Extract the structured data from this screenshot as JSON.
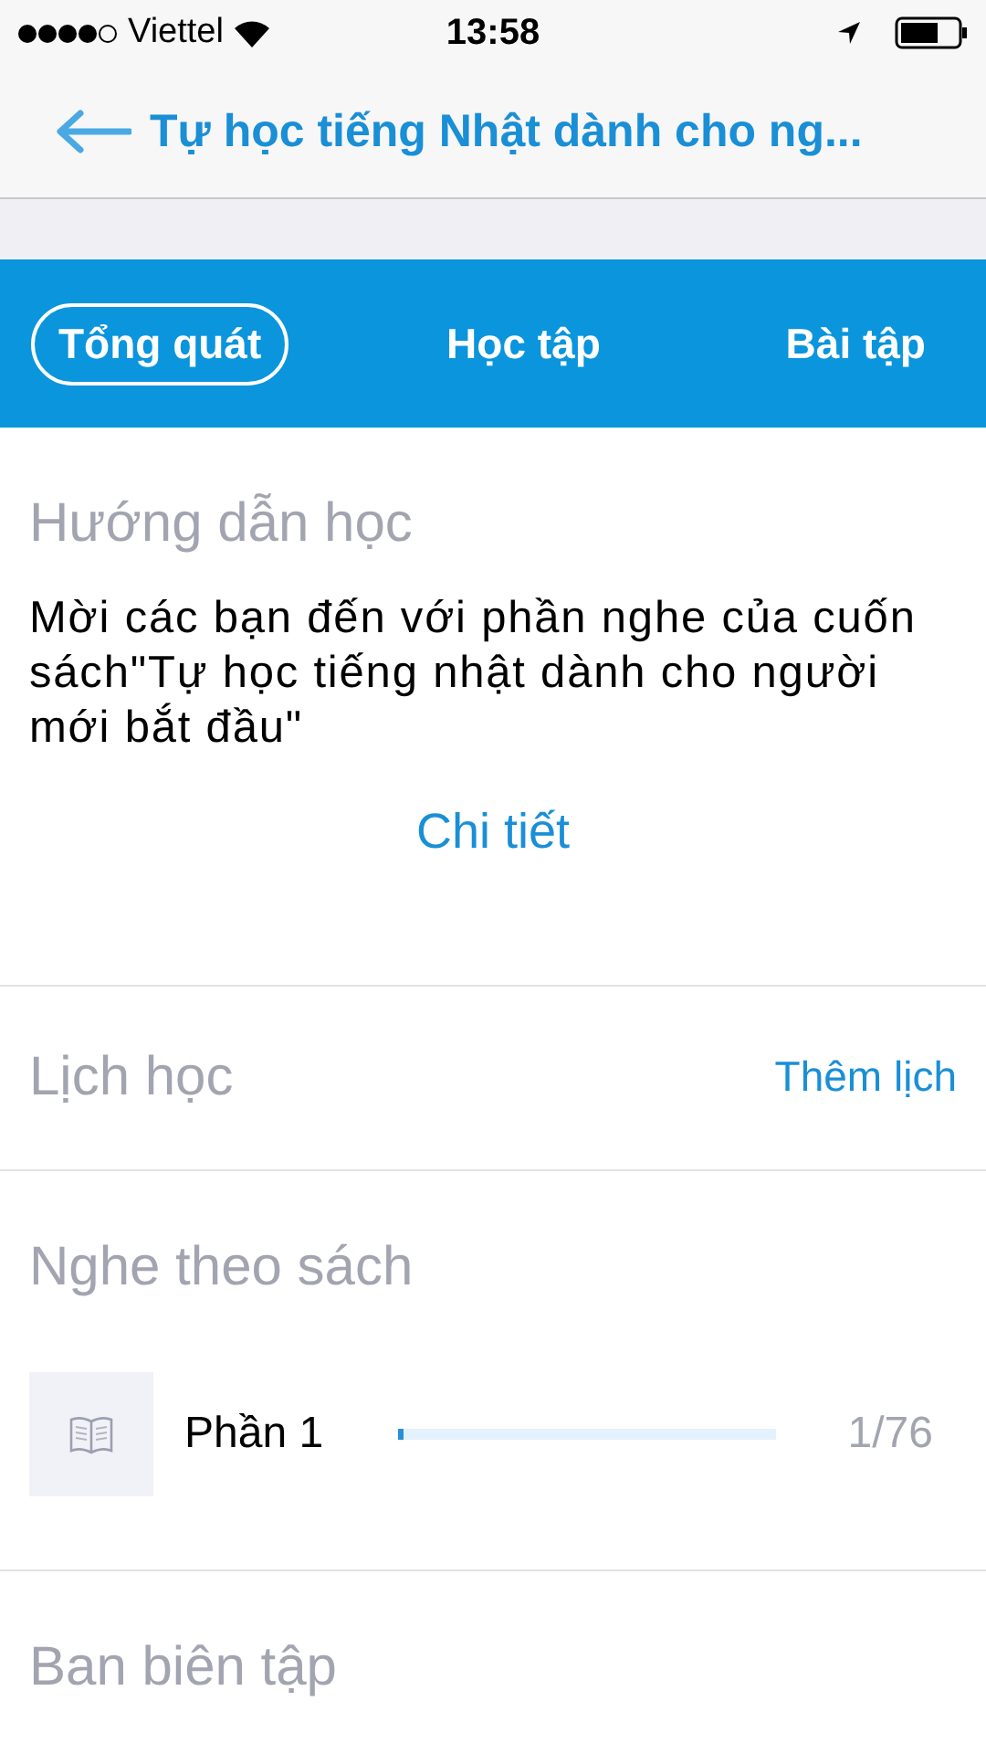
{
  "status_bar": {
    "carrier": "Viettel",
    "time": "13:58"
  },
  "nav": {
    "title": "Tự học tiếng Nhật dành cho ng..."
  },
  "tabs": [
    {
      "label": "Tổng quát",
      "selected": true
    },
    {
      "label": "Học tập",
      "selected": false
    },
    {
      "label": "Bài tập",
      "selected": false
    }
  ],
  "guide": {
    "heading": "Hướng dẫn học",
    "text": "Mời các bạn đến với phần nghe của cuốn sách\"Tự học tiếng nhật dành cho người mới bắt đầu\"",
    "link": "Chi tiết"
  },
  "schedule": {
    "heading": "Lịch học",
    "action": "Thêm lịch"
  },
  "listening": {
    "heading": "Nghe theo sách",
    "items": [
      {
        "title": "Phần 1",
        "level": 0.013,
        "count": "1/76"
      }
    ]
  },
  "editors": {
    "heading": "Ban biên tập"
  }
}
